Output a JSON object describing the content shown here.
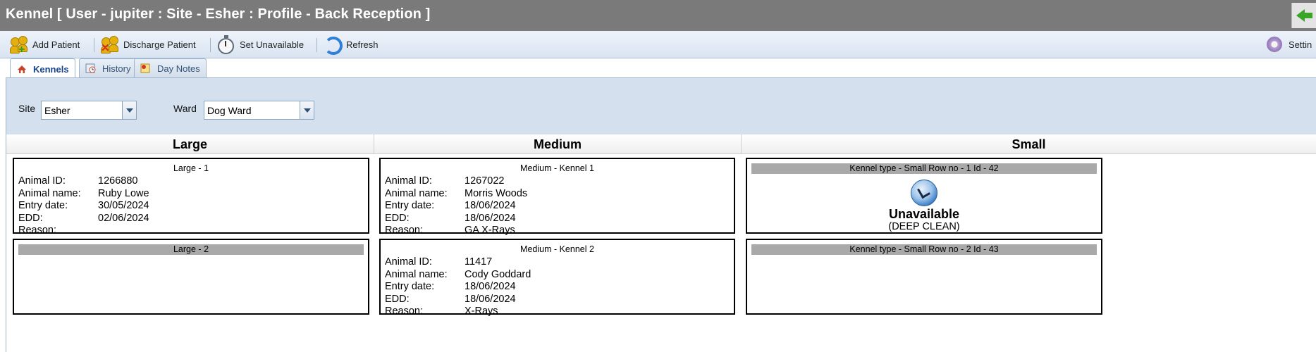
{
  "window": {
    "title": "Kennel [ User - jupiter : Site - Esher : Profile - Back Reception ]",
    "back_icon": "green-left-arrow-icon"
  },
  "toolbar": {
    "add_patient": "Add Patient",
    "discharge_patient": "Discharge Patient",
    "set_unavailable": "Set Unavailable",
    "refresh": "Refresh",
    "settings": "Settin"
  },
  "tabs": [
    {
      "label": "Kennels",
      "active": true
    },
    {
      "label": "History",
      "active": false
    },
    {
      "label": "Day Notes",
      "active": false
    }
  ],
  "filters": {
    "site_label": "Site",
    "site_value": "Esher",
    "ward_label": "Ward",
    "ward_value": "Dog Ward"
  },
  "field_labels": {
    "animal_id": "Animal ID:",
    "animal_name": "Animal name:",
    "entry_date": "Entry date:",
    "edd": "EDD:",
    "reason": "Reason:"
  },
  "columns": [
    {
      "header": "Large",
      "kennels": [
        {
          "name": "Large - 1",
          "occupied": true,
          "animal_id": "1266880",
          "animal_name": "Ruby Lowe",
          "entry_date": "30/05/2024",
          "edd": "02/06/2024",
          "reason": ""
        },
        {
          "name": "Large - 2",
          "occupied": false
        }
      ]
    },
    {
      "header": "Medium",
      "kennels": [
        {
          "name": "Medium - Kennel 1",
          "occupied": true,
          "animal_id": "1267022",
          "animal_name": "Morris Woods",
          "entry_date": "18/06/2024",
          "edd": "18/06/2024",
          "reason": "GA X-Rays"
        },
        {
          "name": "Medium - Kennel 2",
          "occupied": true,
          "animal_id": "11417",
          "animal_name": "Cody Goddard",
          "entry_date": "18/06/2024",
          "edd": "18/06/2024",
          "reason": "X-Rays"
        }
      ]
    },
    {
      "header": "Small",
      "kennels": [
        {
          "name": "Kennel type - Small Row no - 1 Id - 42",
          "occupied": false,
          "unavailable": true,
          "status": "Unavailable",
          "status_reason": "(DEEP CLEAN)"
        },
        {
          "name": "Kennel type - Small Row no - 2 Id - 43",
          "occupied": false
        }
      ]
    }
  ],
  "colors": {
    "titlebar": "#7a7a7a",
    "toolbar": "#dfe8f3",
    "panel": "#d4e0ee",
    "empty_kennel_header": "#a9a9a9"
  }
}
